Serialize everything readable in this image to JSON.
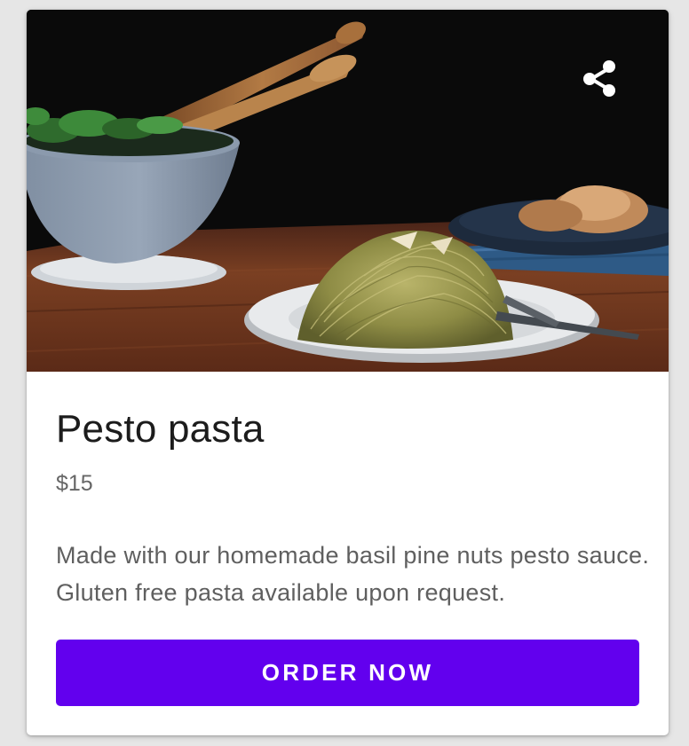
{
  "card": {
    "image_alt": "Pesto pasta dish photo",
    "share_icon": "share-icon",
    "title": "Pesto pasta",
    "price": "$15",
    "description": "Made with our homemade basil pine nuts pesto sauce. Gluten free pasta available upon request.",
    "order_button_label": "ORDER NOW"
  },
  "colors": {
    "accent": "#6200ee",
    "title_text": "#1c1c1c",
    "secondary_text": "#666666"
  }
}
